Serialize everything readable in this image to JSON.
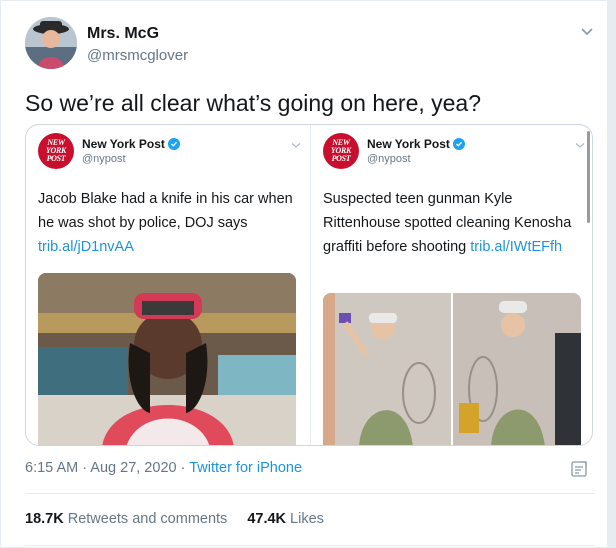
{
  "author": {
    "name": "Mrs. McG",
    "handle": "@mrsmcglover"
  },
  "tweet_text": "So we’re all clear what’s going on here, yea?",
  "embeds": [
    {
      "logo_text": [
        "NEW",
        "YORK",
        "POST"
      ],
      "name": "New York Post",
      "handle": "@nypost",
      "text": "Jacob Blake had a knife in his car when he was shot by police, DOJ says",
      "link": "trib.al/jD1nvAA"
    },
    {
      "logo_text": [
        "NEW",
        "YORK",
        "POST"
      ],
      "name": "New York Post",
      "handle": "@nypost",
      "text": "Suspected teen gunman Kyle Rittenhouse spotted cleaning Kenosha graffiti before shooting",
      "link": "trib.al/IWtEFfh"
    }
  ],
  "meta": {
    "time": "6:15 AM",
    "sep1": " · ",
    "date": "Aug 27, 2020",
    "sep2": " · ",
    "source": "Twitter for iPhone"
  },
  "stats": {
    "retweets_count": "18.7K",
    "retweets_label": "Retweets and comments",
    "likes_count": "47.4K",
    "likes_label": "Likes"
  },
  "colors": {
    "link": "#1b95e0",
    "verified": "#1da1f2",
    "nyp_red": "#c8102e",
    "muted": "#657786"
  },
  "icons": [
    "chevron-down-icon",
    "verified-icon",
    "share-icon"
  ]
}
